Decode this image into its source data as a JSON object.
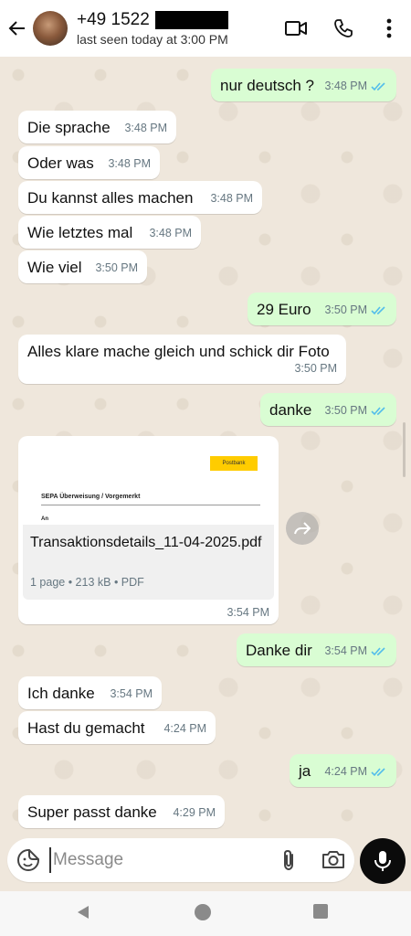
{
  "header": {
    "contact_name": "+49 1522",
    "status": "last seen today at 3:00 PM",
    "icons": [
      "back-arrow-icon",
      "video-call-icon",
      "phone-icon",
      "more-options-icon"
    ]
  },
  "messages": [
    {
      "text": "nur deutsch ?",
      "time": "3:48 PM",
      "direction": "out",
      "read": true
    },
    {
      "text": "Die sprache",
      "time": "3:48 PM",
      "direction": "in"
    },
    {
      "text": "Oder was",
      "time": "3:48 PM",
      "direction": "in"
    },
    {
      "text": "Du kannst alles machen",
      "time": "3:48 PM",
      "direction": "in"
    },
    {
      "text": "Wie letztes mal",
      "time": "3:48 PM",
      "direction": "in"
    },
    {
      "text": "Wie viel",
      "time": "3:50 PM",
      "direction": "in"
    },
    {
      "text": "29 Euro",
      "time": "3:50 PM",
      "direction": "out",
      "read": true
    },
    {
      "text": "Alles klare mache gleich und schick dir Foto",
      "time": "3:50 PM",
      "direction": "in"
    },
    {
      "text": "danke",
      "time": "3:50 PM",
      "direction": "out",
      "read": true
    },
    {
      "text": "Danke dir",
      "time": "3:54 PM",
      "direction": "out",
      "read": true
    },
    {
      "text": "Ich danke",
      "time": "3:54 PM",
      "direction": "in"
    },
    {
      "text": "Hast du gemacht",
      "time": "4:24 PM",
      "direction": "in"
    },
    {
      "text": "ja",
      "time": "4:24 PM",
      "direction": "out",
      "read": true
    },
    {
      "text": "Super passt danke",
      "time": "4:29 PM",
      "direction": "in"
    }
  ],
  "document": {
    "preview_brand": "Postbank",
    "preview_heading": "SEPA Überweisung / Vorgemerkt",
    "preview_field": "An",
    "filename": "Transaktionsdetails_11-04-2025.pdf",
    "details": "1 page • 213 kB • PDF",
    "time": "3:54 PM",
    "brand_color": "#ffcc00"
  },
  "composer": {
    "placeholder": "Message",
    "icons": [
      "sticker-icon",
      "attach-icon",
      "camera-icon",
      "microphone-icon"
    ]
  },
  "colors": {
    "outgoing_bubble": "#d9fdd3",
    "incoming_bubble": "#ffffff",
    "chat_background": "#efe7dc",
    "read_ticks": "#53bdeb"
  }
}
